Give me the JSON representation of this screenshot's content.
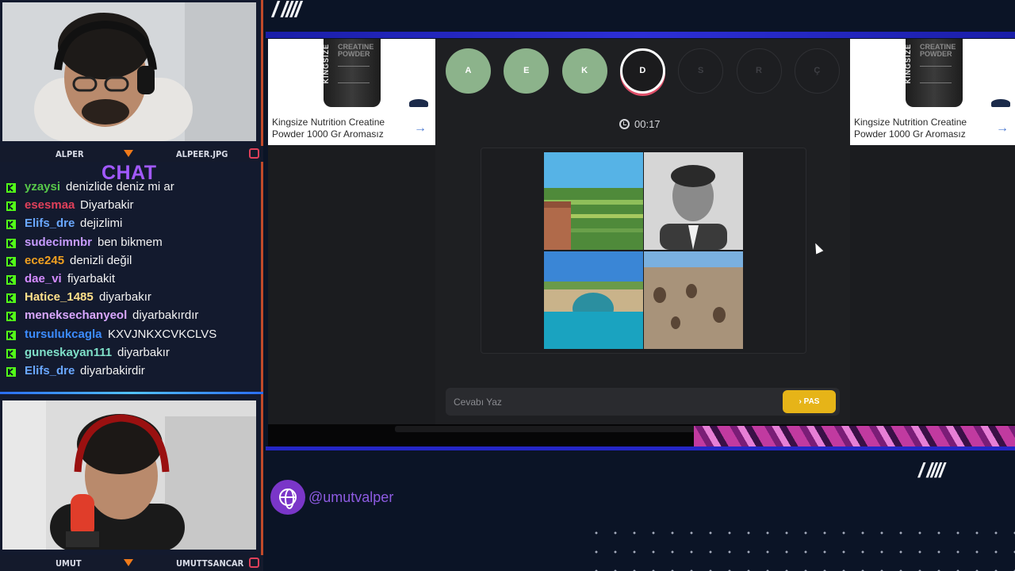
{
  "overlay": {
    "streamer_top": {
      "left_name": "ALPER",
      "right_name": "ALPEER.JPG"
    },
    "streamer_bottom": {
      "left_name": "UMUT",
      "right_name": "UMUTTSANCAR"
    },
    "chat_title": "CHAT",
    "chat_messages": [
      {
        "user": "yzaysi",
        "text": "denizlide deniz mi ar",
        "color": "#57c84a"
      },
      {
        "user": "esesmaa",
        "text": "Diyarbakir",
        "color": "#e0405a"
      },
      {
        "user": "Elifs_dre",
        "text": "dejizlimi",
        "color": "#6aa8ff"
      },
      {
        "user": "sudecimnbr",
        "text": "ben bikmem",
        "color": "#c79bff"
      },
      {
        "user": "ece245",
        "text": "denizli değil",
        "color": "#f0a020"
      },
      {
        "user": "dae_vi",
        "text": "fiyarbakit",
        "color": "#d48bff"
      },
      {
        "user": "Hatice_1485",
        "text": "diyarbakır",
        "color": "#ffe08a"
      },
      {
        "user": "meneksechanyeol",
        "text": "diyarbakırdır",
        "color": "#d9a7ff"
      },
      {
        "user": "tursulukcagla",
        "text": "KXVJNKXCVKCLVS",
        "color": "#3c8cff"
      },
      {
        "user": "guneskayan111",
        "text": "diyarbakır",
        "color": "#7fe0c8"
      },
      {
        "user": "Elifs_dre",
        "text": "diyarbakirdir",
        "color": "#6aa8ff"
      }
    ],
    "social_handle": "@umutvalper"
  },
  "ads": {
    "left": {
      "brand": "KINGSIZE",
      "product": "CREATINE POWDER",
      "title": "Kingsize Nutrition Creatine Powder 1000 Gr Aromasız"
    },
    "right": {
      "brand": "KINGSIZE",
      "product": "CREATINE POWDER",
      "title": "Kingsize Nutrition Creatine Powder 1000 Gr Aromasız"
    }
  },
  "game": {
    "letters": [
      {
        "label": "A",
        "state": "done"
      },
      {
        "label": "E",
        "state": "done"
      },
      {
        "label": "K",
        "state": "done"
      },
      {
        "label": "D",
        "state": "active"
      },
      {
        "label": "S",
        "state": "todo"
      },
      {
        "label": "R",
        "state": "todo"
      },
      {
        "label": "Ç",
        "state": "todo"
      }
    ],
    "timer": "00:17",
    "answer_placeholder": "Cevabı Yaz",
    "pass_label": "PAS",
    "colors": {
      "done": "#8cb38b",
      "active_ring": "#e0506a",
      "pass": "#e6b418"
    }
  }
}
